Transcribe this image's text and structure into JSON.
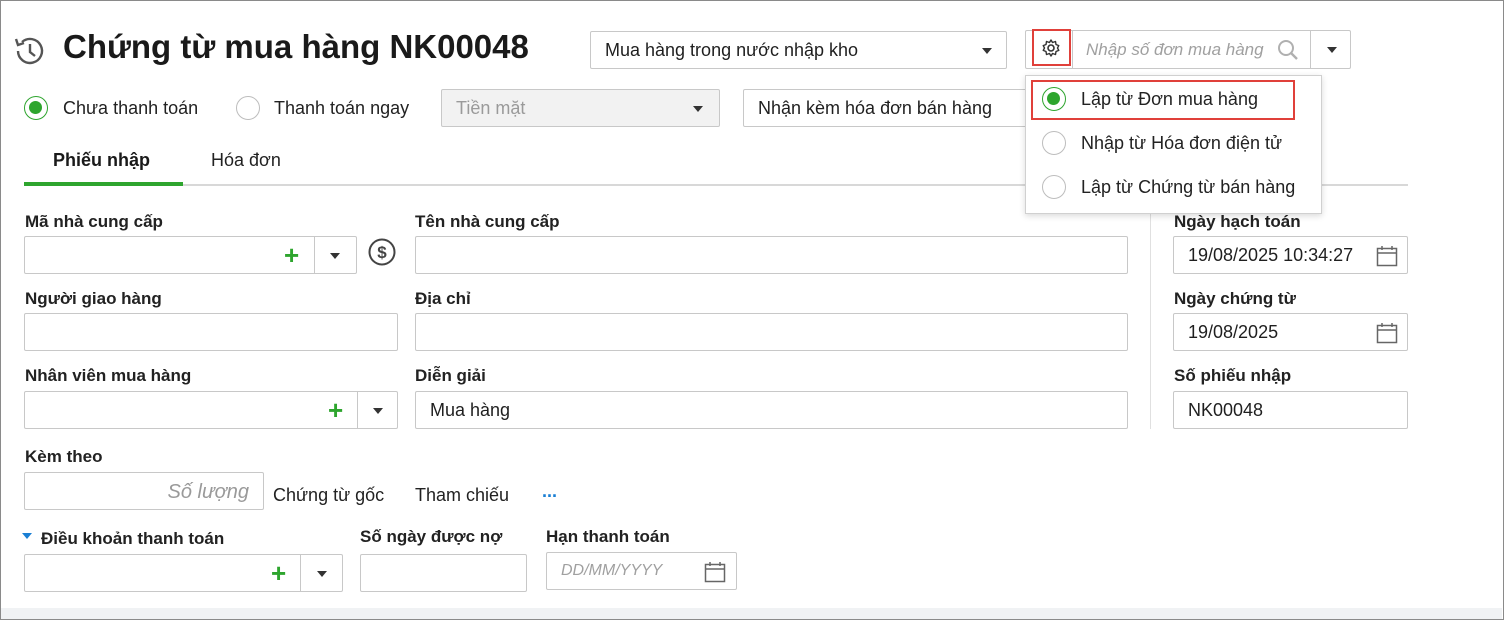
{
  "header": {
    "title": "Chứng từ mua hàng NK00048",
    "purchase_type": "Mua hàng trong nước nhập kho",
    "search_placeholder": "Nhập số đơn mua hàng"
  },
  "payment": {
    "unpaid_label": "Chưa thanh toán",
    "pay_now_label": "Thanh toán ngay",
    "method": "Tiền mặt",
    "invoice_option": "Nhận kèm hóa đơn bán hàng"
  },
  "dropdown_menu": {
    "items": [
      {
        "label": "Lập từ Đơn mua hàng",
        "selected": true
      },
      {
        "label": "Nhập từ Hóa đơn điện tử",
        "selected": false
      },
      {
        "label": "Lập từ Chứng từ bán hàng",
        "selected": false
      }
    ]
  },
  "tabs": [
    {
      "label": "Phiếu nhập",
      "active": true
    },
    {
      "label": "Hóa đơn",
      "active": false
    }
  ],
  "form": {
    "supplier_code_label": "Mã nhà cung cấp",
    "supplier_name_label": "Tên nhà cung cấp",
    "deliverer_label": "Người giao hàng",
    "address_label": "Địa chỉ",
    "buyer_label": "Nhân viên mua hàng",
    "description_label": "Diễn giải",
    "description_value": "Mua hàng",
    "attached_label": "Kèm theo",
    "quantity_placeholder": "Số lượng",
    "original_docs": "Chứng từ gốc",
    "reference_label": "Tham chiếu",
    "more": "...",
    "payment_terms_label": "Điều khoản thanh toán",
    "credit_days_label": "Số ngày được nợ",
    "due_date_label": "Hạn thanh toán",
    "due_date_placeholder": "DD/MM/YYYY"
  },
  "right_panel": {
    "posting_date_label": "Ngày hạch toán",
    "posting_date_value": "19/08/2025 10:34:27",
    "doc_date_label": "Ngày chứng từ",
    "doc_date_value": "19/08/2025",
    "receipt_no_label": "Số phiếu nhập",
    "receipt_no_value": "NK00048"
  },
  "colors": {
    "accent_green": "#2ea52e",
    "highlight_red": "#e0403a",
    "link_blue": "#1a7fd4"
  }
}
